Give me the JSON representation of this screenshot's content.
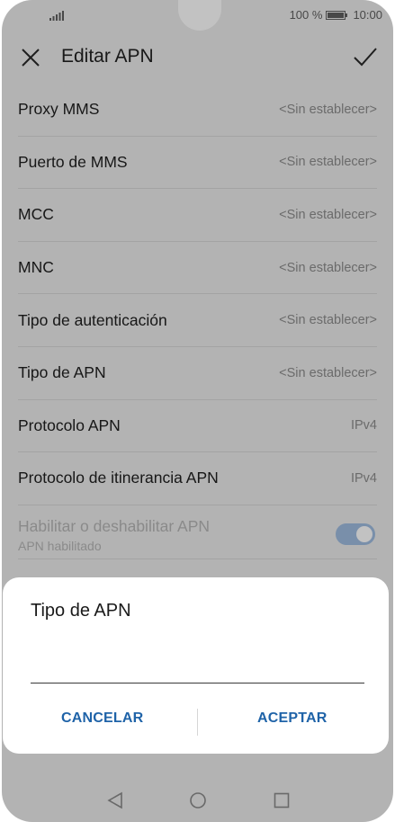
{
  "status_bar": {
    "signal_icon": "signal-bars-icon",
    "battery_percent": "100 %",
    "battery_icon": "battery-full-icon",
    "time": "10:00"
  },
  "app_bar": {
    "close_icon": "close-icon",
    "title": "Editar APN",
    "confirm_icon": "check-icon"
  },
  "settings": [
    {
      "label": "Proxy MMS",
      "value": "<Sin establecer>"
    },
    {
      "label": "Puerto de MMS",
      "value": "<Sin establecer>"
    },
    {
      "label": "MCC",
      "value": "<Sin establecer>"
    },
    {
      "label": "MNC",
      "value": "<Sin establecer>"
    },
    {
      "label": "Tipo de autenticación",
      "value": "<Sin establecer>"
    },
    {
      "label": "Tipo de APN",
      "value": "<Sin establecer>"
    },
    {
      "label": "Protocolo APN",
      "value": "IPv4"
    },
    {
      "label": "Protocolo de itinerancia APN",
      "value": "IPv4"
    }
  ],
  "apn_toggle": {
    "title": "Habilitar o deshabilitar APN",
    "subtitle": "APN habilitado",
    "enabled": true
  },
  "dialog": {
    "title": "Tipo de APN",
    "input_value": "",
    "cancel_label": "CANCELAR",
    "accept_label": "ACEPTAR"
  },
  "nav_bar": {
    "back_icon": "back-triangle-icon",
    "home_icon": "home-circle-icon",
    "recents_icon": "recents-square-icon"
  },
  "colors": {
    "accent": "#1f63a8",
    "toggle_on": "#9fbde0"
  }
}
